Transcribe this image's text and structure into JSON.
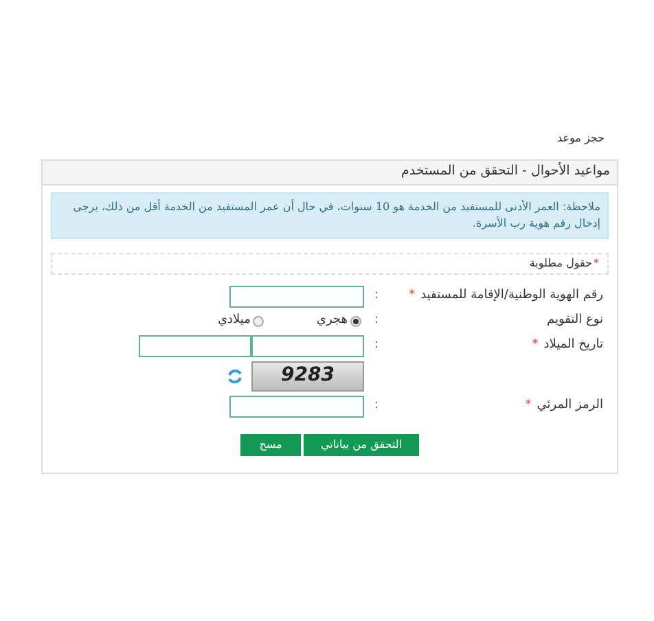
{
  "breadcrumb": "حجز موعد",
  "panel": {
    "title": "مواعيد الأحوال - التحقق من المستخدم",
    "note": "ملاحظة: العمر الأدنى للمستفيد من الخدمة هو 10 سنوات، في حال أن عمر المستفيد من الخدمة أقل من ذلك، يرجى إدخال رقم هوية رب الأسرة.",
    "required_legend": {
      "star": "*",
      "text": "حقول مطلوبة"
    }
  },
  "rows": [
    {
      "kind": "input",
      "label": "رقم الهوية الوطنية/الإقامة للمستفيد",
      "required": true,
      "separator": ":"
    },
    {
      "kind": "radio",
      "label": "نوع التقويم",
      "required": false,
      "separator": ":",
      "options": [
        {
          "label": "هجري",
          "selected": true
        },
        {
          "label": "ميلادي",
          "selected": false
        }
      ]
    },
    {
      "kind": "date",
      "label": "تاريخ الميلاد",
      "required": true,
      "separator": ":"
    },
    {
      "kind": "captcha",
      "captcha": "9283"
    },
    {
      "kind": "input",
      "label": "الرمز المرئي",
      "required": true,
      "separator": ":"
    }
  ],
  "buttons": [
    {
      "label": "التحقق من بياناتي"
    },
    {
      "label": "مسح"
    }
  ]
}
